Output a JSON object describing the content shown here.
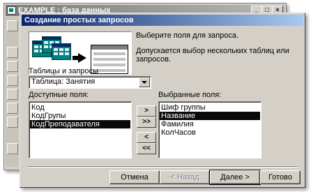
{
  "main_window": {
    "title": "EXAMPLE : база данных",
    "min_label": "_",
    "max_label": "□",
    "close_label": "×"
  },
  "dialog": {
    "title": "Создание простых запросов",
    "instruction": "Выберите поля для запроса.",
    "note_line1": "Допускается выбор нескольких таблиц или",
    "note_line2": "запросов.",
    "tables_label": "Таблицы и запросы",
    "table_selected": "Таблица: Занятия",
    "available_label": "Доступные поля:",
    "selected_label": "Выбранные поля:",
    "available_fields": [
      "Код",
      "КодГрупы",
      "КодПреподавателя"
    ],
    "available_selected_index": 2,
    "selected_fields": [
      "Шиф группы",
      "Название",
      "Фамилия",
      "КолЧасов"
    ],
    "selected_selected_index": 1,
    "move_buttons": [
      ">",
      ">>",
      "<",
      "<<"
    ],
    "buttons": {
      "cancel": "Отмена",
      "back": "< Назад",
      "next": "Далее >",
      "finish": "Готово"
    }
  }
}
